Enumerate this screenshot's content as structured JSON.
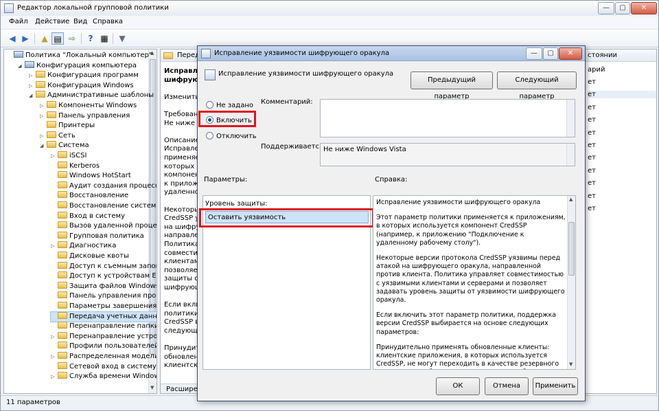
{
  "main_window": {
    "title": "Редактор локальной групповой политики",
    "controls": {
      "minimize": "—",
      "maximize": "▢",
      "close": "✕"
    },
    "menu": [
      "Файл",
      "Действие",
      "Вид",
      "Справка"
    ],
    "status": "11 параметров"
  },
  "tree": {
    "items": [
      {
        "label": "Политика \"Локальный компьютер\"",
        "icon": "computer-policy-icon",
        "level": 0,
        "arrow": ""
      },
      {
        "label": "Конфигурация компьютера",
        "icon": "computer-icon",
        "level": 1,
        "arrow": "◢"
      },
      {
        "label": "Конфигурация программ",
        "icon": "folder-icon",
        "level": 2,
        "arrow": "▷"
      },
      {
        "label": "Конфигурация Windows",
        "icon": "folder-icon",
        "level": 2,
        "arrow": "▷"
      },
      {
        "label": "Административные шаблоны",
        "icon": "folder-icon",
        "level": 2,
        "arrow": "◢"
      },
      {
        "label": "Компоненты Windows",
        "icon": "folder-icon",
        "level": 3,
        "arrow": "▷"
      },
      {
        "label": "Панель управления",
        "icon": "folder-icon",
        "level": 3,
        "arrow": "▷"
      },
      {
        "label": "Принтеры",
        "icon": "folder-icon",
        "level": 3,
        "arrow": ""
      },
      {
        "label": "Сеть",
        "icon": "folder-icon",
        "level": 3,
        "arrow": "▷"
      },
      {
        "label": "Система",
        "icon": "folder-icon",
        "level": 3,
        "arrow": "◢"
      },
      {
        "label": "iSCSI",
        "icon": "folder-icon",
        "level": 4,
        "arrow": "▷"
      },
      {
        "label": "Kerberos",
        "icon": "folder-icon",
        "level": 4,
        "arrow": ""
      },
      {
        "label": "Windows HotStart",
        "icon": "folder-icon",
        "level": 4,
        "arrow": ""
      },
      {
        "label": "Аудит создания процессов",
        "icon": "folder-icon",
        "level": 4,
        "arrow": ""
      },
      {
        "label": "Восстановление",
        "icon": "folder-icon",
        "level": 4,
        "arrow": ""
      },
      {
        "label": "Восстановление системы",
        "icon": "folder-icon",
        "level": 4,
        "arrow": ""
      },
      {
        "label": "Вход в систему",
        "icon": "folder-icon",
        "level": 4,
        "arrow": ""
      },
      {
        "label": "Вызов удаленной процедуры",
        "icon": "folder-icon",
        "level": 4,
        "arrow": ""
      },
      {
        "label": "Групповая политика",
        "icon": "folder-icon",
        "level": 4,
        "arrow": ""
      },
      {
        "label": "Диагностика",
        "icon": "folder-icon",
        "level": 4,
        "arrow": "▷"
      },
      {
        "label": "Дисковые квоты",
        "icon": "folder-icon",
        "level": 4,
        "arrow": ""
      },
      {
        "label": "Доступ к съемным запоминающим",
        "icon": "folder-icon",
        "level": 4,
        "arrow": ""
      },
      {
        "label": "Доступ к устройствам Enhanced",
        "icon": "folder-icon",
        "level": 4,
        "arrow": ""
      },
      {
        "label": "Защита файлов Windows",
        "icon": "folder-icon",
        "level": 4,
        "arrow": ""
      },
      {
        "label": "Панель управления производительностью",
        "icon": "folder-icon",
        "level": 4,
        "arrow": ""
      },
      {
        "label": "Параметры завершения работы",
        "icon": "folder-icon",
        "level": 4,
        "arrow": ""
      },
      {
        "label": "Передача учетных данных",
        "icon": "folder-icon",
        "level": 4,
        "arrow": "",
        "selected": true
      },
      {
        "label": "Перенаправление папки",
        "icon": "folder-icon",
        "level": 4,
        "arrow": ""
      },
      {
        "label": "Перенаправление устройств",
        "icon": "folder-icon",
        "level": 4,
        "arrow": "▷"
      },
      {
        "label": "Профили пользователей",
        "icon": "folder-icon",
        "level": 4,
        "arrow": ""
      },
      {
        "label": "Распределенная модель COM",
        "icon": "folder-icon",
        "level": 4,
        "arrow": "▷"
      },
      {
        "label": "Сетевой вход в систему",
        "icon": "folder-icon",
        "level": 4,
        "arrow": ""
      },
      {
        "label": "Служба времени Windows",
        "icon": "folder-icon",
        "level": 4,
        "arrow": "▷"
      }
    ]
  },
  "content": {
    "header": "Переда",
    "lines": [
      "Исправлен",
      "шифрующег",
      "",
      "Изменить",
      "",
      "Требовани",
      "Не ниже W",
      "",
      "Описание:",
      "Исправлен",
      "применяет",
      "которых ис",
      "компонент",
      "к приложе",
      "удаленном",
      "",
      "Некоторые",
      "CredSSP уя",
      "на шифрую",
      "направлен",
      "Политика у",
      "совместим",
      "клиентами",
      "позволяет",
      "защиты от",
      "шифрующег",
      "",
      "Если вклю",
      "политики,",
      "CredSSP вы",
      "следующи",
      "",
      "Принудите",
      "обновлен",
      "клиентски"
    ],
    "tab": "Расширен"
  },
  "right_column": {
    "header": "стоянии",
    "header2": "арий",
    "rows": [
      "ет",
      "ет",
      "ет",
      "ет",
      "ет",
      "ет",
      "ет",
      "ет",
      "ет",
      "ет",
      "ет"
    ]
  },
  "dialog": {
    "title": "Исправление уязвимости шифрующего оракула",
    "setting_name": "Исправление уязвимости шифрующего оракула",
    "prev_button": "Предыдущий параметр",
    "next_button": "Следующий параметр",
    "radio_not_configured": "Не задано",
    "radio_enabled": "Включить",
    "radio_disabled": "Отключить",
    "comment_label": "Комментарий:",
    "supported_label": "Поддерживается:",
    "supported_value": "Не ниже Windows Vista",
    "params_label": "Параметры:",
    "help_label": "Справка:",
    "protection_label": "Уровень защиты:",
    "protection_value": "Оставить уязвимость",
    "help_paragraphs": [
      "Исправление уязвимости шифрующего оракула",
      "Этот параметр политики применяется к приложениям, в которых используется компонент CredSSP (например, к приложению \"Подключение к удаленному рабочему столу\").",
      "Некоторые версии протокола CredSSP уязвимы перед атакой на шифрующего оракула, направленной против клиента. Политика управляет совместимостью с уязвимыми клиентами и серверами и позволяет задавать уровень защиты от уязвимости шифрующего оракула.",
      "Если включить этот параметр политики, поддержка версии CredSSP выбирается на основе следующих параметров:",
      "Принудительно применять обновленные клиенты: клиентские приложения, в которых используется CredSSP, не могут переходить в качестве резервного варианта на небезопасные версии, и службы, где применяется CredSSP, не принимают неисправленные клиенты. Примечание. Этот"
    ],
    "ok": "ОК",
    "cancel": "Отмена",
    "apply": "Применить"
  },
  "colors": {
    "highlight": "#e0141e",
    "selection": "#cde3f7",
    "title_blue": "#a9c1e2"
  }
}
